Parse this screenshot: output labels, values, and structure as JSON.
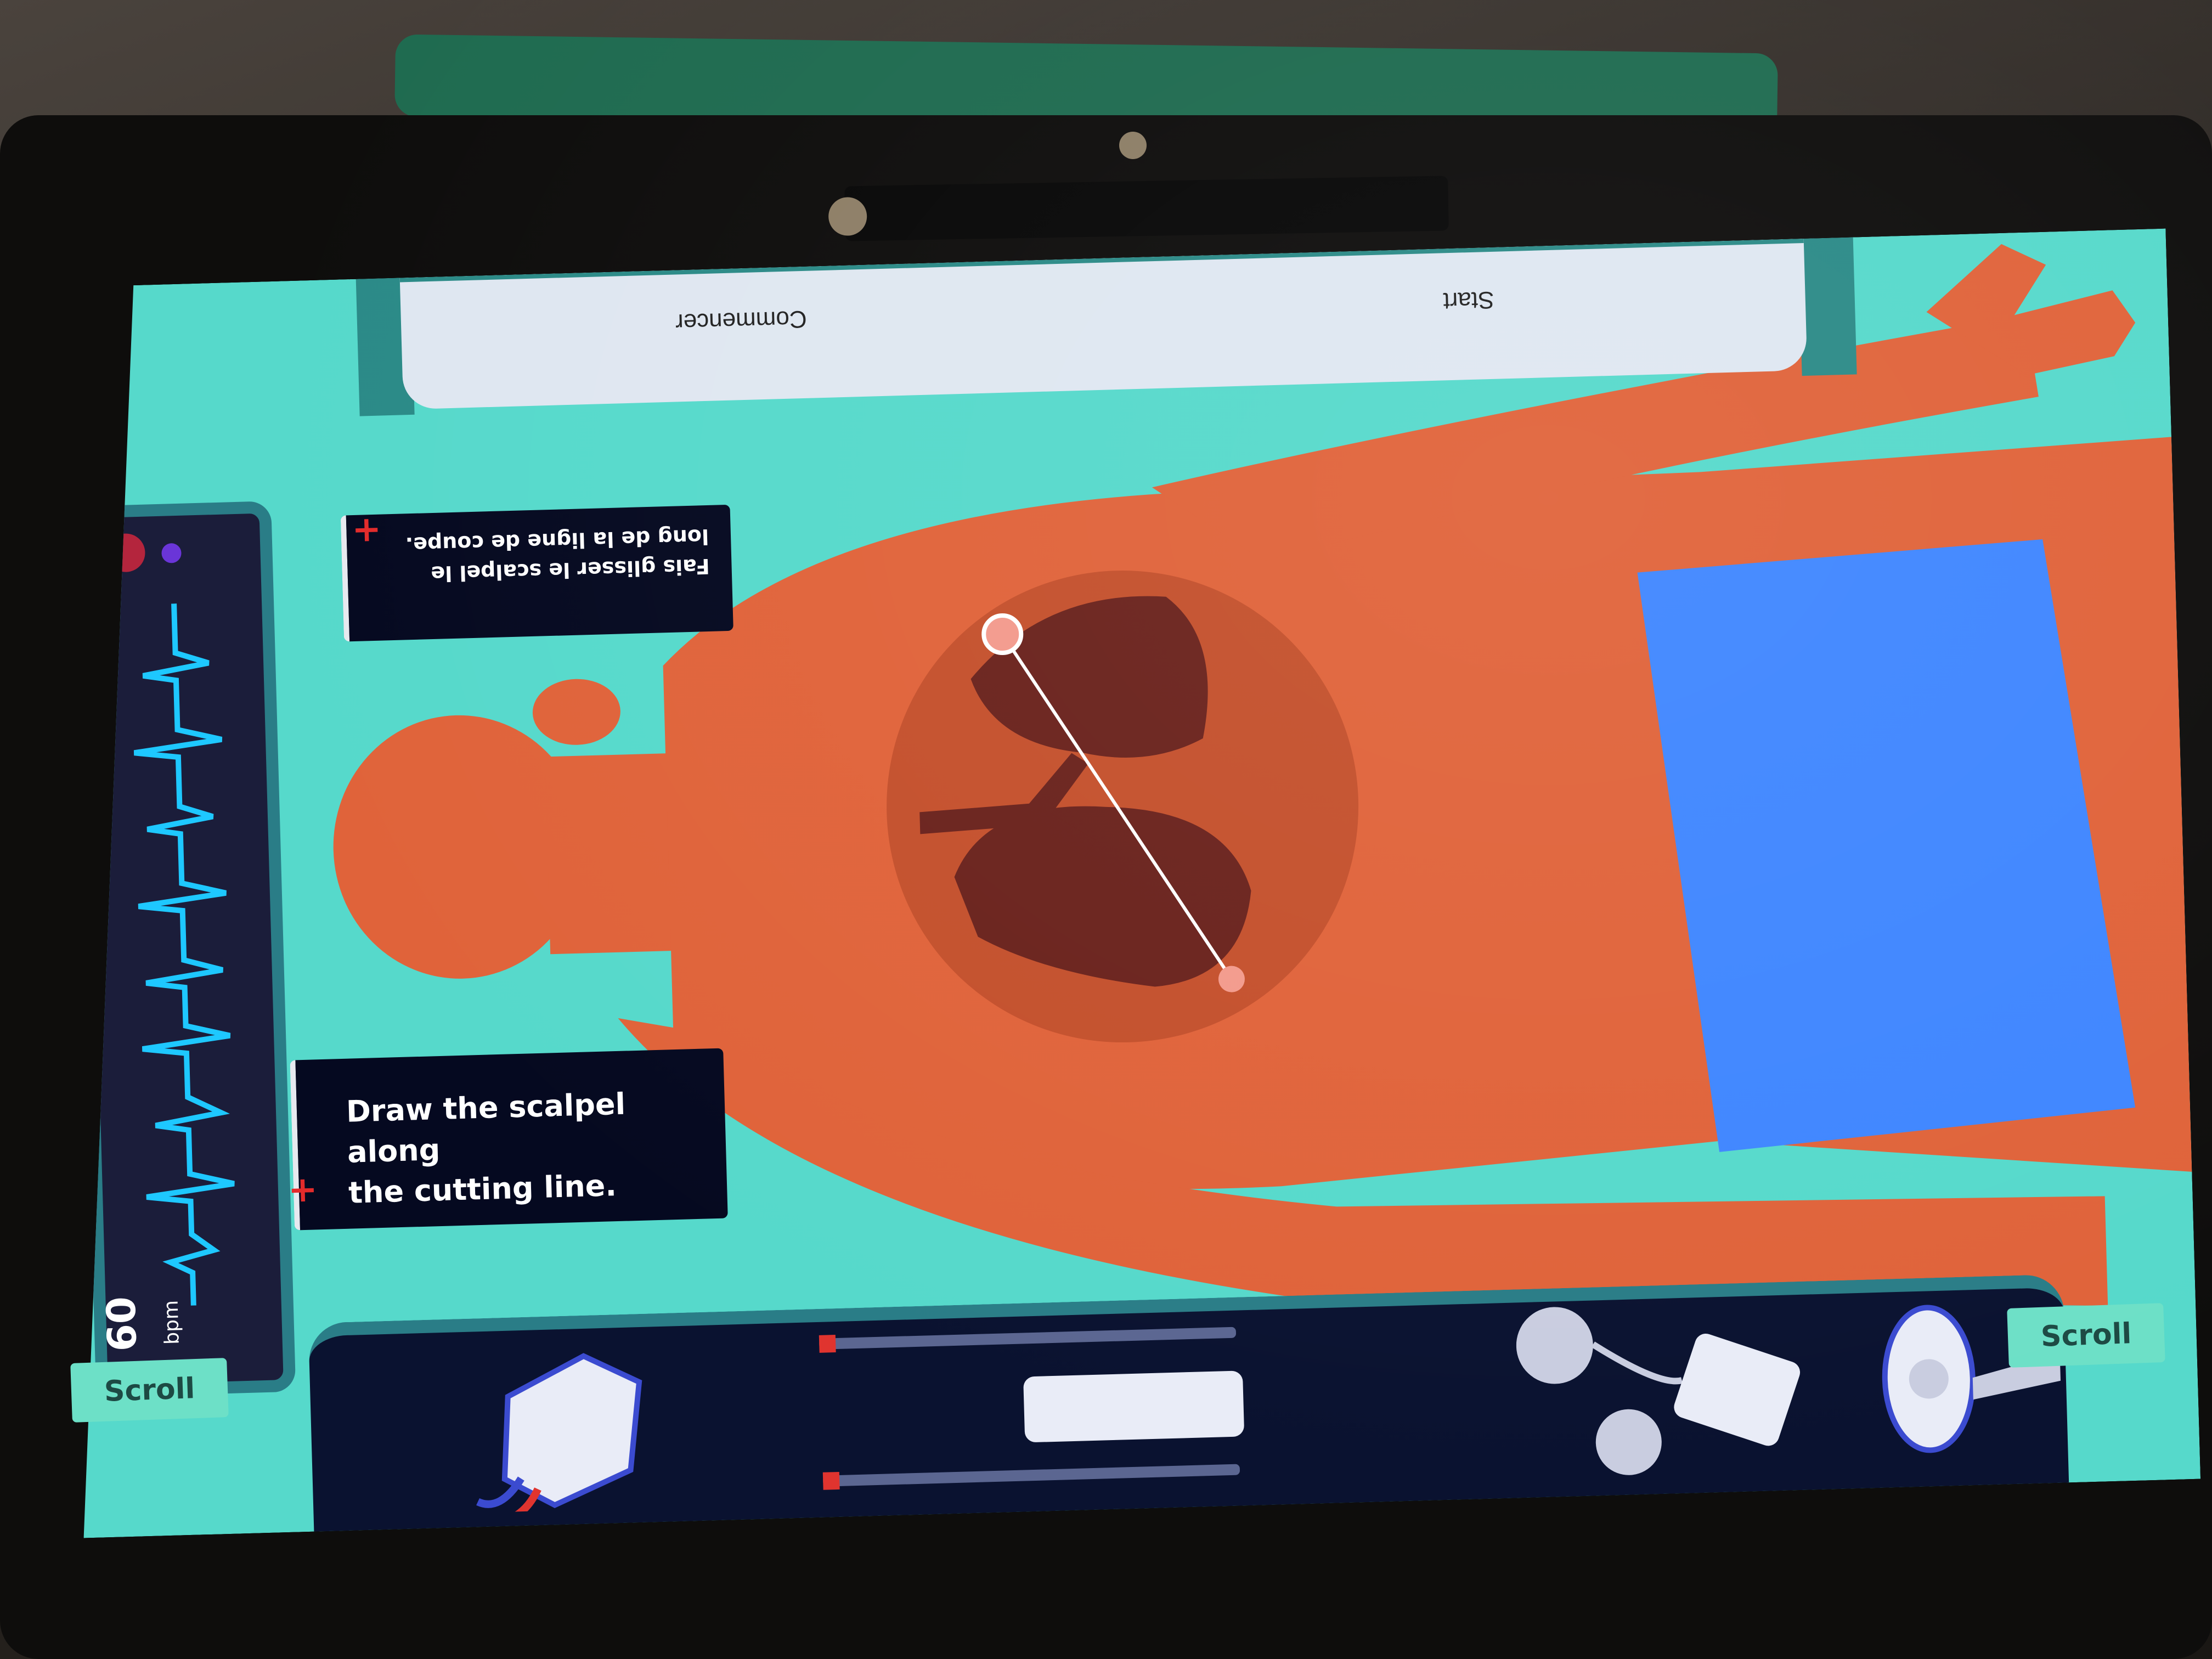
{
  "top_drawer": {
    "label_start": "Start",
    "label_commencer": "Commencer"
  },
  "monitor": {
    "bpm_value": "60",
    "bpm_unit": "bpm"
  },
  "instruction_en": {
    "line1": "Draw the scalpel along",
    "line2": "the cutting line."
  },
  "instruction_fr": {
    "text": "Fais glisser le scalpel le long de la ligne de coupe."
  },
  "tools": [
    "heart-lung-machine-icon",
    "syringe-pump-icon",
    "pacemaker-icon",
    "catheter-port-icon"
  ],
  "scroll": {
    "left": "Scroll",
    "right": "Scroll"
  },
  "colors": {
    "screen_bg": "#56d9cb",
    "skin": "#e0633a",
    "shorts": "#3f86ff",
    "tray": "#0a1230",
    "ecg": "#1ec8ff"
  }
}
